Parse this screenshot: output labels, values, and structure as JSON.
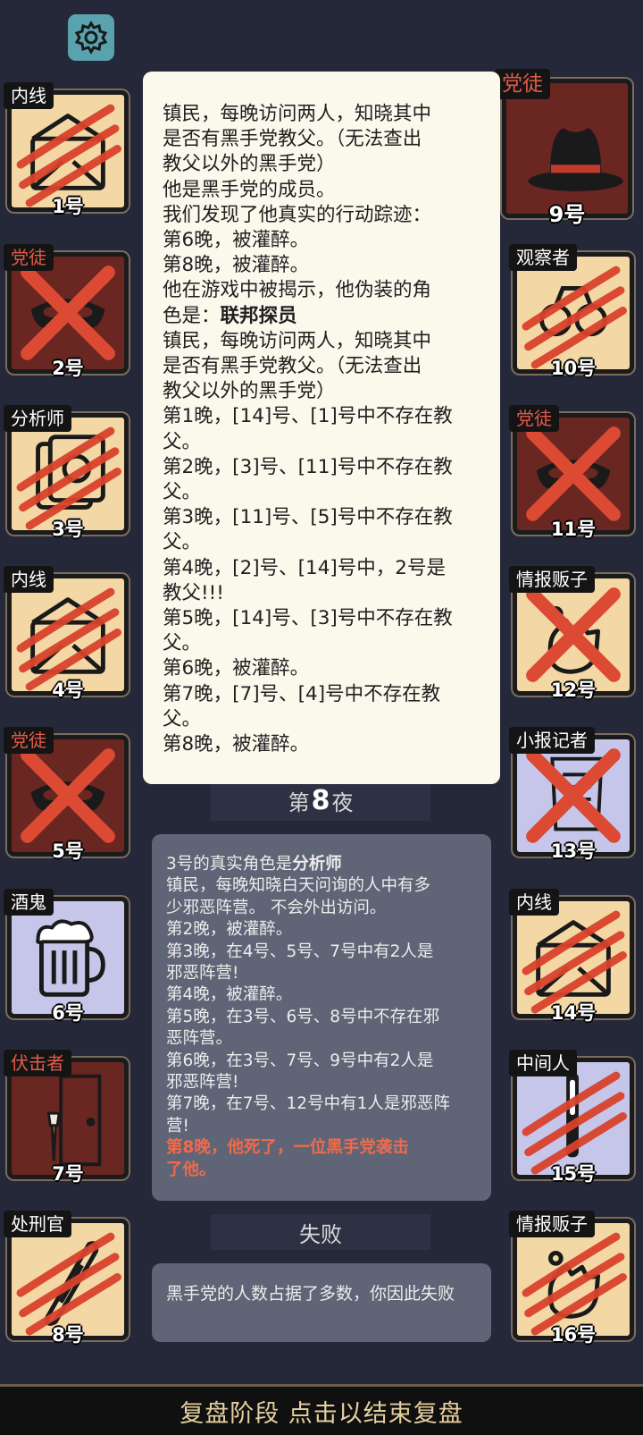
{
  "settings_icon": "gear-icon",
  "cards_left": [
    {
      "role": "内线",
      "num": "1号",
      "bg": "beige",
      "icon": "envelope-icon",
      "mark": "claw",
      "label_red": false
    },
    {
      "role": "党徒",
      "num": "2号",
      "bg": "maroon",
      "icon": "mask-icon",
      "mark": "x",
      "label_red": true
    },
    {
      "role": "分析师",
      "num": "3号",
      "bg": "beige",
      "icon": "papers-icon",
      "mark": "claw",
      "label_red": false
    },
    {
      "role": "内线",
      "num": "4号",
      "bg": "beige",
      "icon": "envelope-icon",
      "mark": "claw",
      "label_red": false
    },
    {
      "role": "党徒",
      "num": "5号",
      "bg": "maroon",
      "icon": "mask-icon",
      "mark": "x",
      "label_red": true
    },
    {
      "role": "酒鬼",
      "num": "6号",
      "bg": "lav",
      "icon": "beer-icon",
      "mark": "none",
      "label_red": false
    },
    {
      "role": "伏击者",
      "num": "7号",
      "bg": "maroon",
      "icon": "door-knife-icon",
      "mark": "none",
      "label_red": true
    },
    {
      "role": "处刑官",
      "num": "8号",
      "bg": "beige",
      "icon": "scroll-icon",
      "mark": "claw",
      "label_red": false
    }
  ],
  "cards_right": [
    {
      "role": "观察者",
      "num": "10号",
      "bg": "beige",
      "icon": "binoculars-icon",
      "mark": "claw",
      "label_red": false
    },
    {
      "role": "党徒",
      "num": "11号",
      "bg": "maroon",
      "icon": "mask-icon",
      "mark": "x",
      "label_red": true
    },
    {
      "role": "情报贩子",
      "num": "12号",
      "bg": "beige",
      "icon": "hand-icon",
      "mark": "x",
      "label_red": false
    },
    {
      "role": "小报记者",
      "num": "13号",
      "bg": "lav",
      "icon": "newspaper-icon",
      "mark": "x",
      "label_red": false
    },
    {
      "role": "内线",
      "num": "14号",
      "bg": "beige",
      "icon": "envelope-icon",
      "mark": "claw",
      "label_red": false
    },
    {
      "role": "中间人",
      "num": "15号",
      "bg": "lav",
      "icon": "pen-icon",
      "mark": "claw",
      "label_red": false
    },
    {
      "role": "情报贩子",
      "num": "16号",
      "bg": "beige",
      "icon": "hand-icon",
      "mark": "claw",
      "label_red": false
    }
  ],
  "card_9": {
    "role": "党徒",
    "num": "9号",
    "bg": "maroon",
    "icon": "fedora-hat-icon",
    "mark": "none",
    "label_red": true
  },
  "popup": {
    "lines": [
      "镇民，每晚访问两人，知晓其中",
      "是否有黑手党教父。（无法查出",
      "教父以外的黑手党）",
      "他是黑手党的成员。",
      "我们发现了他真实的行动踪迹：",
      "第6晚，被灌醉。",
      "第8晚，被灌醉。",
      "他在游戏中被揭示，他伪装的角",
      "色是：",
      "镇民，每晚访问两人，知晓其中",
      "是否有黑手党教父。（无法查出",
      "教父以外的黑手党）",
      "第1晚，[14]号、[1]号中不存在教",
      "父。",
      "第2晚，[3]号、[11]号中不存在教",
      "父。",
      "第3晚，[11]号、[5]号中不存在教",
      "父。",
      "第4晚，[2]号、[14]号中，2号是",
      "教父!!!",
      "第5晚，[14]号、[3]号中不存在教",
      "父。",
      "第6晚，被灌醉。",
      "第7晚，[7]号、[4]号中不存在教",
      "父。",
      "第8晚，被灌醉。"
    ],
    "disguise_role": "联邦探员"
  },
  "night": {
    "prefix": "第",
    "number": "8",
    "suffix": "夜"
  },
  "log": {
    "title_prefix": "3号的真实角色是",
    "title_role": "分析师",
    "lines": [
      "镇民，每晚知晓白天问询的人中有多",
      "少邪恶阵营。 不会外出访问。",
      "第2晚，被灌醉。",
      "第3晚，在4号、5号、7号中有2人是",
      "邪恶阵营!",
      "第4晚，被灌醉。",
      "第5晚，在3号、6号、8号中不存在邪",
      "恶阵营。",
      "第6晚，在3号、7号、9号中有2人是",
      "邪恶阵营!",
      "第7晚，在7号、12号中有1人是邪恶阵",
      "营!"
    ],
    "death_lines": [
      "第8晚，他死了，一位黑手党袭击",
      "了他。"
    ]
  },
  "result": {
    "title": "失败",
    "text": "黑手党的人数占据了多数，你因此失败"
  },
  "bottom_bar": "复盘阶段 点击以结束复盘",
  "colors": {
    "background": "#252838",
    "beige_card": "#f3d8a5",
    "maroon_card": "#6a2621",
    "lavender_card": "#c6c6ea",
    "claw_red": "#d8432c",
    "accent_gold": "#e6cf9e",
    "death_text": "#f06a4c"
  }
}
